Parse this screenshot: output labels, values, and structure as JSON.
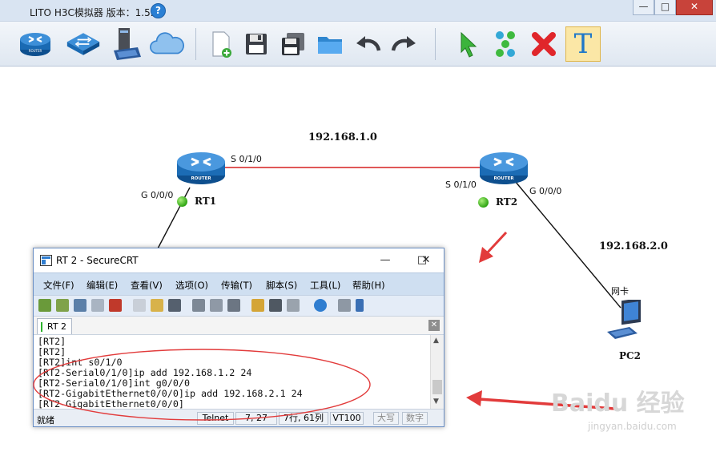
{
  "app": {
    "title": "LITO H3C模拟器 版本：1.5.2",
    "help_glyph": "?",
    "window_controls": {
      "minimize": "—",
      "maximize": "□",
      "close": "✕"
    }
  },
  "toolbar": {
    "items": [
      {
        "name": "router-tool",
        "icon": "router-icon"
      },
      {
        "name": "switch-tool",
        "icon": "switch-icon"
      },
      {
        "name": "pc-tool",
        "icon": "pc-icon"
      },
      {
        "name": "cloud-tool",
        "icon": "cloud-icon"
      },
      {
        "name": "new-file",
        "icon": "new-file-icon"
      },
      {
        "name": "save",
        "icon": "save-icon"
      },
      {
        "name": "save-as",
        "icon": "save-as-icon"
      },
      {
        "name": "open-folder",
        "icon": "folder-icon"
      },
      {
        "name": "undo",
        "icon": "undo-icon"
      },
      {
        "name": "redo",
        "icon": "redo-icon"
      },
      {
        "name": "select",
        "icon": "pointer-icon"
      },
      {
        "name": "connect",
        "icon": "link-icon"
      },
      {
        "name": "delete",
        "icon": "delete-icon"
      },
      {
        "name": "text",
        "icon": "text-icon",
        "active": true,
        "glyph": "T"
      }
    ]
  },
  "topology": {
    "devices": [
      {
        "id": "RT1",
        "label": "RT1",
        "type": "router",
        "device_text": "ROUTER",
        "status": "up"
      },
      {
        "id": "RT2",
        "label": "RT2",
        "type": "router",
        "device_text": "ROUTER",
        "status": "up"
      },
      {
        "id": "PC2",
        "label": "PC2",
        "type": "pc"
      }
    ],
    "interfaces": {
      "rt1_serial": "S 0/1/0",
      "rt1_gig": "G 0/0/0",
      "rt2_serial": "S 0/1/0",
      "rt2_gig": "G 0/0/0",
      "pc2_nic": "网卡"
    },
    "networks": {
      "serial_link": "192.168.1.0",
      "lan_link": "192.168.2.0"
    },
    "colors": {
      "serial_link": "#d62020",
      "ethernet_link": "#111111",
      "status_up": "#2fa513"
    }
  },
  "securecrt": {
    "title": "RT 2 - SecureCRT",
    "window_controls": {
      "minimize": "—",
      "maximize": "□",
      "close": "✕"
    },
    "menu": [
      "文件(F)",
      "编辑(E)",
      "查看(V)",
      "选项(O)",
      "传输(T)",
      "脚本(S)",
      "工具(L)",
      "帮助(H)"
    ],
    "tab": {
      "label": "RT 2",
      "close_glyph": "✕"
    },
    "terminal_lines": [
      "[RT2]",
      "[RT2]",
      "[RT2]int s0/1/0",
      "[RT2-Serial0/1/0]ip add 192.168.1.2 24",
      "[RT2-Serial0/1/0]int g0/0/0",
      "[RT2-GigabitEthernet0/0/0]ip add 192.168.2.1 24",
      "[RT2-GigabitEthernet0/0/0]"
    ],
    "status": {
      "ready": "就绪",
      "protocol": "Telnet",
      "cursor": "7,  27",
      "size": "7行, 61列",
      "emulation": "VT100",
      "caps": "大写",
      "num": "数字"
    },
    "scroll": {
      "up": "▲",
      "down": "▼"
    }
  },
  "annotation": {
    "color": "#e23b3b"
  },
  "watermark": {
    "text": "Baidu 经验",
    "sub": "jingyan.baidu.com"
  }
}
